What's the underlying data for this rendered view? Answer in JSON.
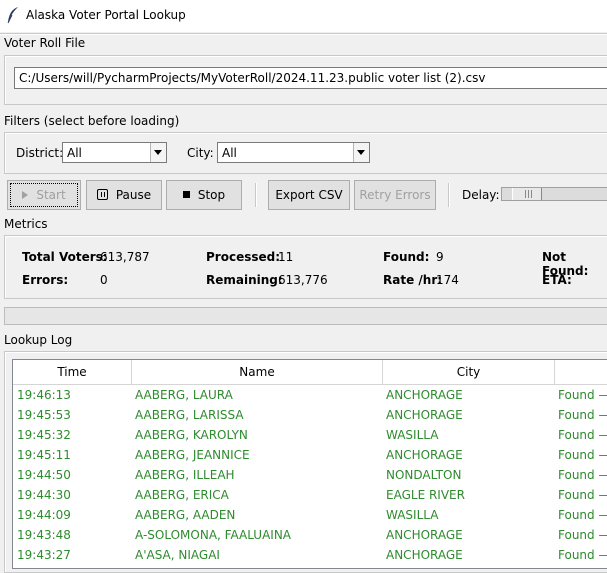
{
  "window": {
    "title": "Alaska Voter Portal Lookup",
    "icon": "feather-icon"
  },
  "voter_roll": {
    "label": "Voter Roll File",
    "path": "C:/Users/will/PycharmProjects/MyVoterRoll/2024.11.23.public voter list (2).csv"
  },
  "filters": {
    "label": "Filters  (select before loading)",
    "district_label": "District:",
    "district_value": "All",
    "city_label": "City:",
    "city_value": "All"
  },
  "toolbar": {
    "start": "Start",
    "pause": "Pause",
    "stop": "Stop",
    "export": "Export CSV",
    "retry": "Retry Errors",
    "delay_label": "Delay:"
  },
  "metrics": {
    "label": "Metrics",
    "total_voters_label": "Total Voters:",
    "total_voters": "613,787",
    "processed_label": "Processed:",
    "processed": "11",
    "found_label": "Found:",
    "found": "9",
    "not_found_label": "Not Found:",
    "errors_label": "Errors:",
    "errors": "0",
    "remaining_label": "Remaining:",
    "remaining": "613,776",
    "rate_label": "Rate /hr:",
    "rate": "174",
    "eta_label": "ETA:"
  },
  "log": {
    "label": "Lookup Log",
    "columns": [
      "Time",
      "Name",
      "City"
    ],
    "rows": [
      {
        "time": "19:46:13",
        "name": "AABERG, LAURA",
        "city": "ANCHORAGE",
        "status": "Found —"
      },
      {
        "time": "19:45:53",
        "name": "AABERG, LARISSA",
        "city": "ANCHORAGE",
        "status": "Found —"
      },
      {
        "time": "19:45:32",
        "name": "AABERG, KAROLYN",
        "city": "WASILLA",
        "status": "Found —"
      },
      {
        "time": "19:45:11",
        "name": "AABERG, JEANNICE",
        "city": "ANCHORAGE",
        "status": "Found —"
      },
      {
        "time": "19:44:50",
        "name": "AABERG, ILLEAH",
        "city": "NONDALTON",
        "status": "Found —"
      },
      {
        "time": "19:44:30",
        "name": "AABERG, ERICA",
        "city": "EAGLE RIVER",
        "status": "Found —"
      },
      {
        "time": "19:44:09",
        "name": "AABERG, AADEN",
        "city": "WASILLA",
        "status": "Found —"
      },
      {
        "time": "19:43:48",
        "name": "A-SOLOMONA, FAALUAINA",
        "city": "ANCHORAGE",
        "status": "Found —"
      },
      {
        "time": "19:43:27",
        "name": "A'ASA, NIAGAI",
        "city": "ANCHORAGE",
        "status": "Found —"
      }
    ]
  },
  "colors": {
    "found_text": "#2e8b2e",
    "window_bg": "#f0f0f0"
  }
}
